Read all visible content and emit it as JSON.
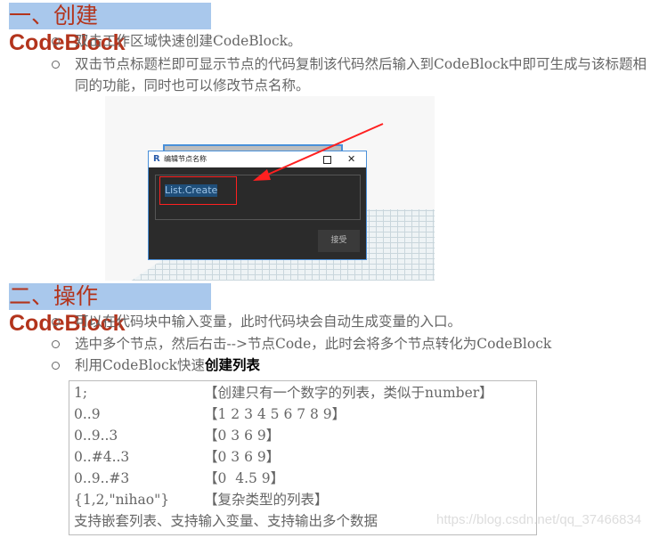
{
  "section1": {
    "title_prefix": "一、创建",
    "title_bold": "CodeBlock",
    "items": [
      "双击工作区域快速创建CodeBlock。",
      "双击节点标题栏即可显示节点的代码复制该代码然后输入到CodeBlock中即可生成与该标题相同的功能，同时也可以修改节点名称。"
    ]
  },
  "dialog": {
    "title": "编辑节点名称",
    "value": "List.Create",
    "accept_label": "接受",
    "icon": "revit-R-icon"
  },
  "section2": {
    "title_prefix": "二、操作",
    "title_bold": "CodeBlock",
    "items": [
      "可以在代码块中输入变量，此时代码块会自动生成变量的入口。",
      "选中多个节点，然后右击-->节点Code，此时会将多个节点转化为CodeBlock"
    ],
    "item3_prefix": "利用CodeBlock快速",
    "item3_bold": "创建列表"
  },
  "code_rows": [
    {
      "code": "1;",
      "desc": "【创建只有一个数字的列表，类似于number】"
    },
    {
      "code": "0..9",
      "desc": "【1 2 3 4 5 6 7 8 9】"
    },
    {
      "code": "0..9..3",
      "desc": "【0 3 6 9】"
    },
    {
      "code": "0..#4..3",
      "desc": "【0 3 6 9】"
    },
    {
      "code": "0..9..#3",
      "desc": "【0  4.5 9】"
    },
    {
      "code": "{1,2,\"nihao\"}",
      "desc": "【复杂类型的列表】"
    }
  ],
  "code_footer": "支持嵌套列表、支持输入变量、支持输出多个数据",
  "watermark": "https://blog.csdn.net/qq_37466834",
  "colors": {
    "heading_bg": "#a9c8ec",
    "heading_text": "#b3341c",
    "annotation": "#ff2020"
  }
}
